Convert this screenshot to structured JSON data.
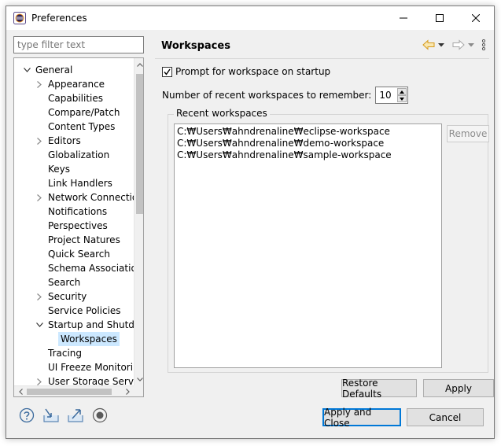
{
  "window": {
    "title": "Preferences"
  },
  "filter": {
    "placeholder": "type filter text"
  },
  "tree": {
    "items": [
      {
        "label": "General",
        "level": 0,
        "expander": "expanded"
      },
      {
        "label": "Appearance",
        "level": 1,
        "expander": "collapsed"
      },
      {
        "label": "Capabilities",
        "level": 1,
        "expander": "none"
      },
      {
        "label": "Compare/Patch",
        "level": 1,
        "expander": "none"
      },
      {
        "label": "Content Types",
        "level": 1,
        "expander": "none"
      },
      {
        "label": "Editors",
        "level": 1,
        "expander": "collapsed"
      },
      {
        "label": "Globalization",
        "level": 1,
        "expander": "none"
      },
      {
        "label": "Keys",
        "level": 1,
        "expander": "none"
      },
      {
        "label": "Link Handlers",
        "level": 1,
        "expander": "none"
      },
      {
        "label": "Network Connection",
        "level": 1,
        "expander": "collapsed"
      },
      {
        "label": "Notifications",
        "level": 1,
        "expander": "none"
      },
      {
        "label": "Perspectives",
        "level": 1,
        "expander": "none"
      },
      {
        "label": "Project Natures",
        "level": 1,
        "expander": "none"
      },
      {
        "label": "Quick Search",
        "level": 1,
        "expander": "none"
      },
      {
        "label": "Schema Associations",
        "level": 1,
        "expander": "none"
      },
      {
        "label": "Search",
        "level": 1,
        "expander": "none"
      },
      {
        "label": "Security",
        "level": 1,
        "expander": "collapsed"
      },
      {
        "label": "Service Policies",
        "level": 1,
        "expander": "none"
      },
      {
        "label": "Startup and Shutdown",
        "level": 1,
        "expander": "expanded"
      },
      {
        "label": "Workspaces",
        "level": 2,
        "expander": "none",
        "selected": true
      },
      {
        "label": "Tracing",
        "level": 1,
        "expander": "none"
      },
      {
        "label": "UI Freeze Monitoring",
        "level": 1,
        "expander": "none"
      },
      {
        "label": "User Storage Service",
        "level": 1,
        "expander": "collapsed"
      }
    ]
  },
  "page": {
    "title": "Workspaces",
    "prompt_label": "Prompt for workspace on startup",
    "prompt_checked": true,
    "recent_count_label": "Number of recent workspaces to remember:",
    "recent_count_value": "10",
    "recent_group_label": "Recent workspaces",
    "recent_workspaces": [
      "C:₩Users₩ahndrenaline₩eclipse-workspace",
      "C:₩Users₩ahndrenaline₩demo-workspace",
      "C:₩Users₩ahndrenaline₩sample-workspace"
    ],
    "remove_label": "Remove",
    "restore_defaults_label": "Restore Defaults",
    "apply_label": "Apply"
  },
  "footer": {
    "apply_close_label": "Apply and Close",
    "cancel_label": "Cancel"
  },
  "icons": {
    "app": "eclipse-icon",
    "help": "help-icon",
    "import": "import-icon",
    "export": "export-icon",
    "record": "record-icon"
  },
  "colors": {
    "selection": "#cce8ff",
    "default_button_border": "#0078d7",
    "nav_back_arrow": "#e8b64c"
  }
}
